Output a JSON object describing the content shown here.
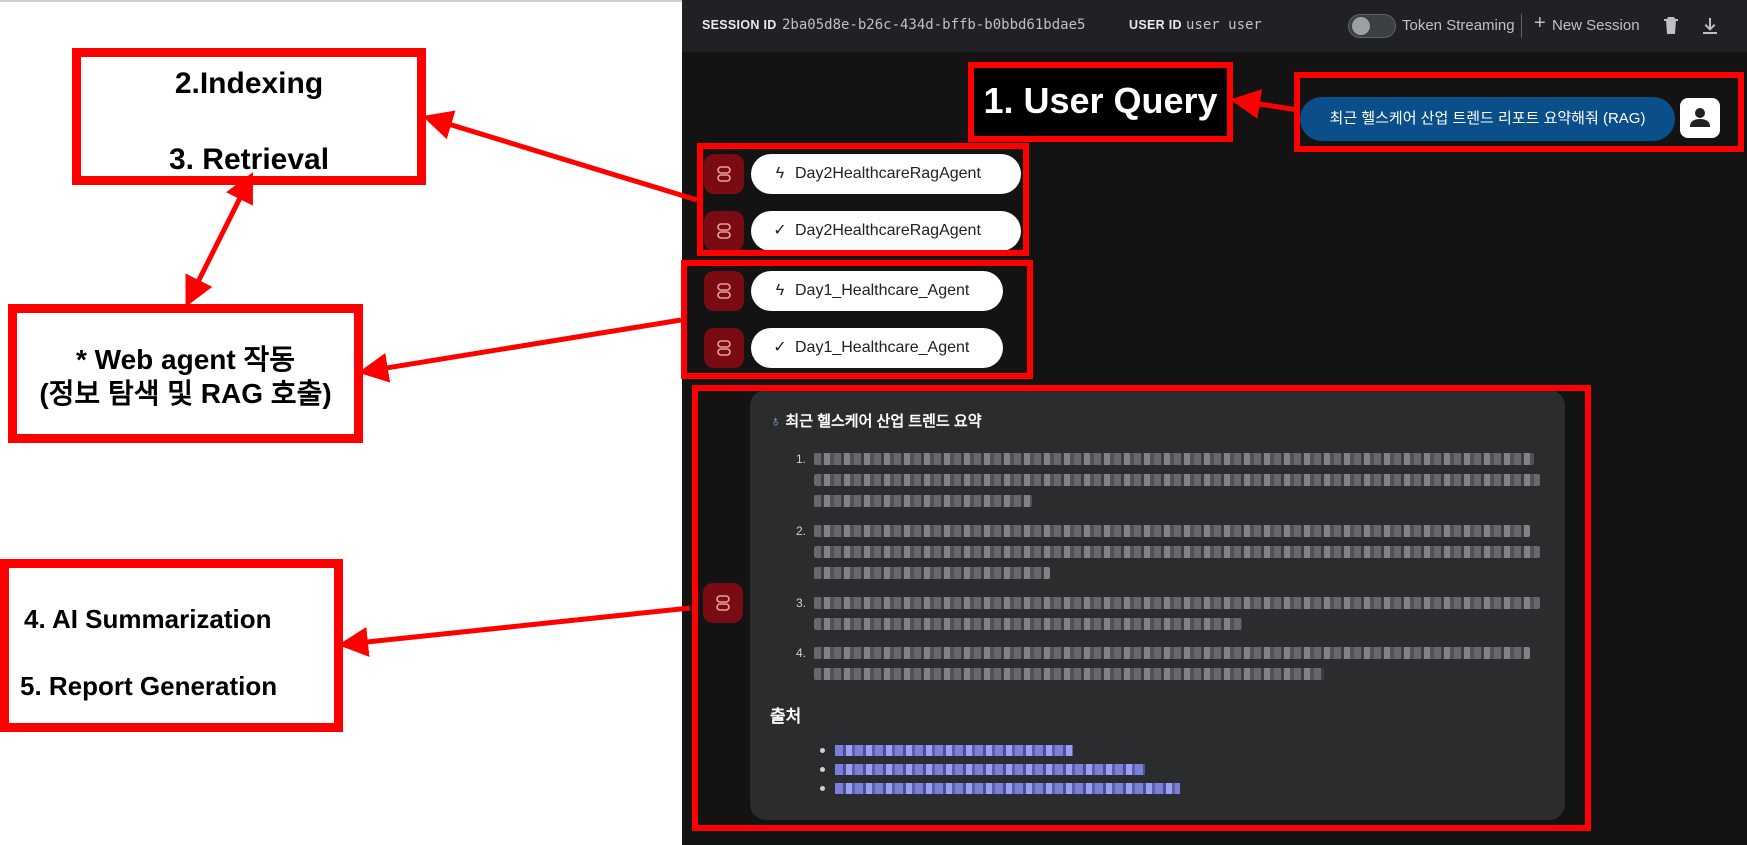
{
  "annotations": {
    "indexing": "2.Indexing",
    "retrieval": "3. Retrieval",
    "web_agent_line1": "* Web agent 작동",
    "web_agent_line2": "(정보 탐색 및 RAG 호출)",
    "summarization": "4. AI Summarization",
    "report": "5. Report Generation",
    "user_query": "1. User Query"
  },
  "topbar": {
    "session_label": "SESSION ID",
    "session_value": "2ba05d8e-b26c-434d-bffb-b0bbd61bdae5",
    "user_label": "USER ID",
    "user_value": "user user",
    "token_streaming": "Token Streaming",
    "token_streaming_on": false,
    "new_session": "New Session"
  },
  "chat": {
    "user_query": "최근 헬스케어 산업 트렌드 리포트 요약해줘 (RAG)",
    "events": [
      {
        "agent": "Day2HealthcareRagAgent",
        "icon": "bolt-icon"
      },
      {
        "agent": "Day2HealthcareRagAgent",
        "icon": "check-icon"
      },
      {
        "agent": "Day1_Healthcare_Agent",
        "icon": "bolt-icon"
      },
      {
        "agent": "Day1_Healthcare_Agent",
        "icon": "check-icon"
      }
    ],
    "response": {
      "title": "최근 헬스케어 산업 트렌드 요약",
      "sources_heading": "출처"
    }
  },
  "colors": {
    "annotation_red": "#ff0000",
    "query_chip": "#0b4f8a",
    "bot_icon": "#7a0b12",
    "app_bg": "#131314",
    "topbar_bg": "#202124",
    "card_bg": "#2b2c2e"
  }
}
